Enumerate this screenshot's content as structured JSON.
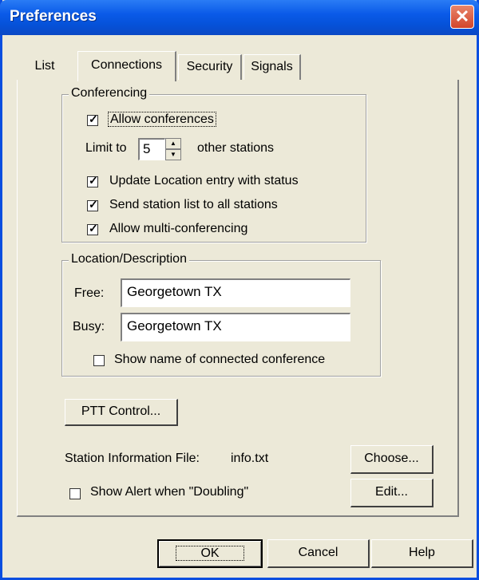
{
  "window": {
    "title": "Preferences",
    "close_label": "✕"
  },
  "tabs": [
    {
      "label": "List"
    },
    {
      "label": "Connections"
    },
    {
      "label": "Security"
    },
    {
      "label": "Signals"
    }
  ],
  "conferencing": {
    "legend": "Conferencing",
    "allow_conferences": {
      "label": "Allow conferences",
      "checked": true
    },
    "limit_label": "Limit to",
    "limit_value": "5",
    "limit_suffix": "other stations",
    "update_location": {
      "label": "Update Location entry with status",
      "checked": true
    },
    "send_station_list": {
      "label": "Send station list to all stations",
      "checked": true
    },
    "allow_multi": {
      "label": "Allow multi-conferencing",
      "checked": true
    }
  },
  "location": {
    "legend": "Location/Description",
    "free_label": "Free:",
    "free_value": "Georgetown TX",
    "busy_label": "Busy:",
    "busy_value": "Georgetown TX",
    "show_name": {
      "label": "Show name of connected conference",
      "checked": false
    }
  },
  "ptt_button": "PTT Control...",
  "station_info": {
    "label": "Station Information File:",
    "value": "info.txt"
  },
  "choose_button": "Choose...",
  "edit_button": "Edit...",
  "show_alert": {
    "label": "Show Alert when \"Doubling\"",
    "checked": false
  },
  "footer": {
    "ok": "OK",
    "cancel": "Cancel",
    "help": "Help"
  },
  "check_glyph": "✓"
}
